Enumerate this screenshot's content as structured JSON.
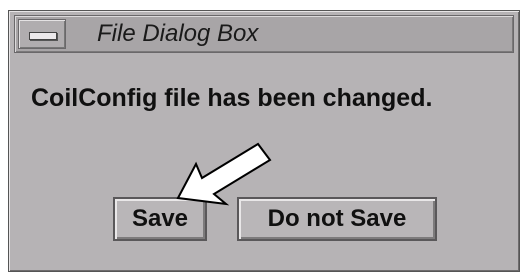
{
  "dialog": {
    "title": "File Dialog Box",
    "message": "CoilConfig file has been changed.",
    "buttons": {
      "save_label": "Save",
      "do_not_save_label": "Do not Save"
    }
  },
  "icons": {
    "window_menu": "window-menu-icon",
    "pointer": "arrow-pointer-icon"
  },
  "colors": {
    "window_bg": "#b6b3b5",
    "titlebar_bg": "#a8a5a7",
    "text": "#101010"
  }
}
